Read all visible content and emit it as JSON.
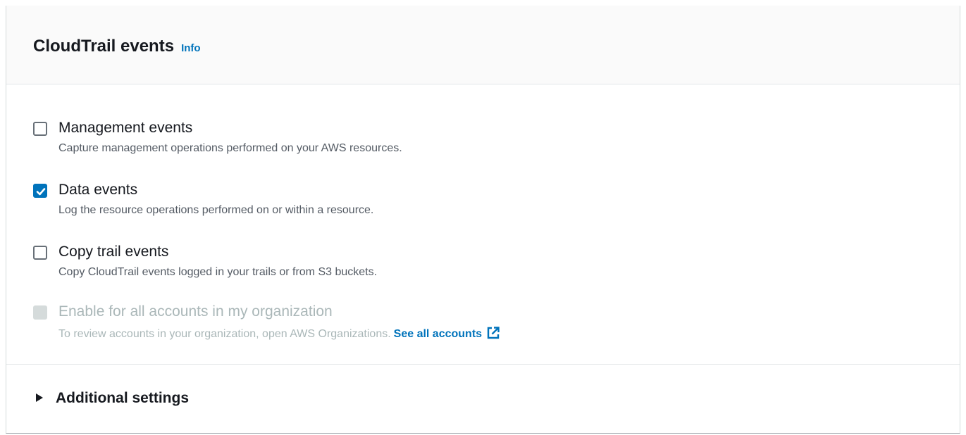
{
  "panel": {
    "title": "CloudTrail events",
    "info_label": "Info"
  },
  "options": [
    {
      "label": "Management events",
      "description": "Capture management operations performed on your AWS resources.",
      "checked": false
    },
    {
      "label": "Data events",
      "description": "Log the resource operations performed on or within a resource.",
      "checked": true
    },
    {
      "label": "Copy trail events",
      "description": "Copy CloudTrail events logged in your trails or from S3 buckets.",
      "checked": false
    },
    {
      "label": "Enable for all accounts in my organization",
      "description": "To review accounts in your organization, open AWS Organizations.",
      "link_label": "See all accounts",
      "checked": false,
      "disabled": true
    }
  ],
  "additional_settings": {
    "label": "Additional settings",
    "expanded": false
  },
  "colors": {
    "accent": "#0073bb",
    "text": "#16191f",
    "muted_text": "#545b64",
    "disabled": "#aab7b8",
    "header_bg": "#fafafa"
  },
  "icons": {
    "checkmark": "checkmark-icon",
    "external_link": "external-link-icon",
    "caret": "caret-right-icon"
  }
}
